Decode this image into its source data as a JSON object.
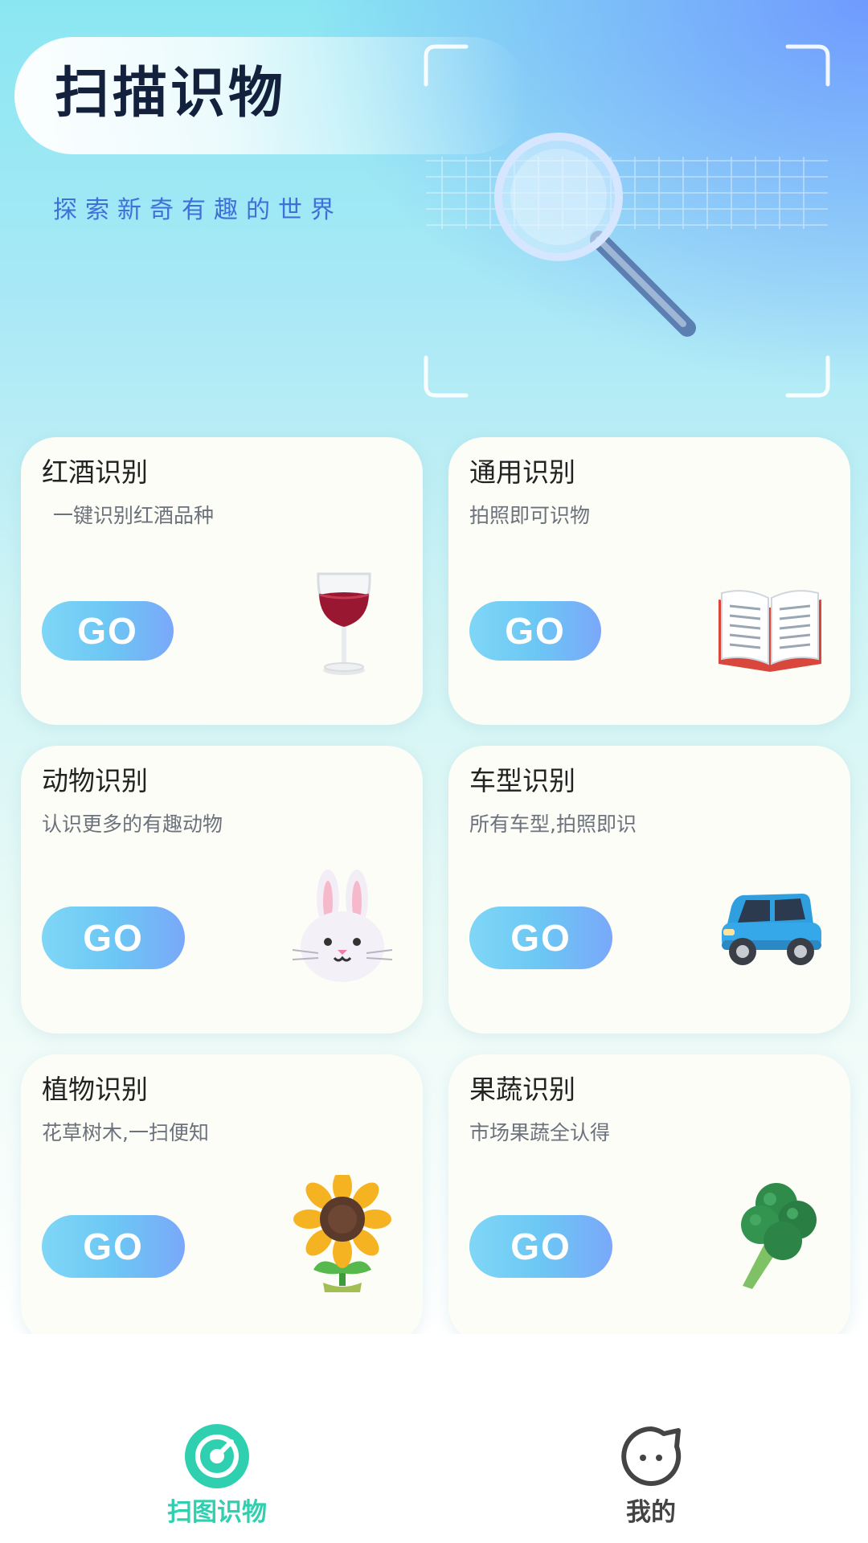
{
  "header": {
    "title": "扫描识物",
    "subtitle": "探索新奇有趣的世界",
    "hero_icon": "magnifier-scan-icon"
  },
  "cards": [
    {
      "title": "红酒识别",
      "desc": "一键识别红酒品种",
      "button": "GO",
      "icon": "wine-glass-icon"
    },
    {
      "title": "通用识别",
      "desc": "拍照即可识物",
      "button": "GO",
      "icon": "open-book-icon"
    },
    {
      "title": "动物识别",
      "desc": "认识更多的有趣动物",
      "button": "GO",
      "icon": "rabbit-icon"
    },
    {
      "title": "车型识别",
      "desc": "所有车型,拍照即识",
      "button": "GO",
      "icon": "car-icon"
    },
    {
      "title": "植物识别",
      "desc": "花草树木,一扫便知",
      "button": "GO",
      "icon": "sunflower-icon"
    },
    {
      "title": "果蔬识别",
      "desc": "市场果蔬全认得",
      "button": "GO",
      "icon": "broccoli-icon"
    }
  ],
  "bottom_nav": {
    "items": [
      {
        "label": "扫图识物",
        "icon": "scan-radar-icon",
        "active": true,
        "color": "#2fd0b0"
      },
      {
        "label": "我的",
        "icon": "smiley-face-icon",
        "active": false,
        "color": "#444444"
      }
    ]
  },
  "colors": {
    "accent_teal": "#2fd0b0",
    "subtitle_blue": "#3f6fd8",
    "go_button_start": "#7fd6f6",
    "go_button_end": "#7aa8f9"
  }
}
